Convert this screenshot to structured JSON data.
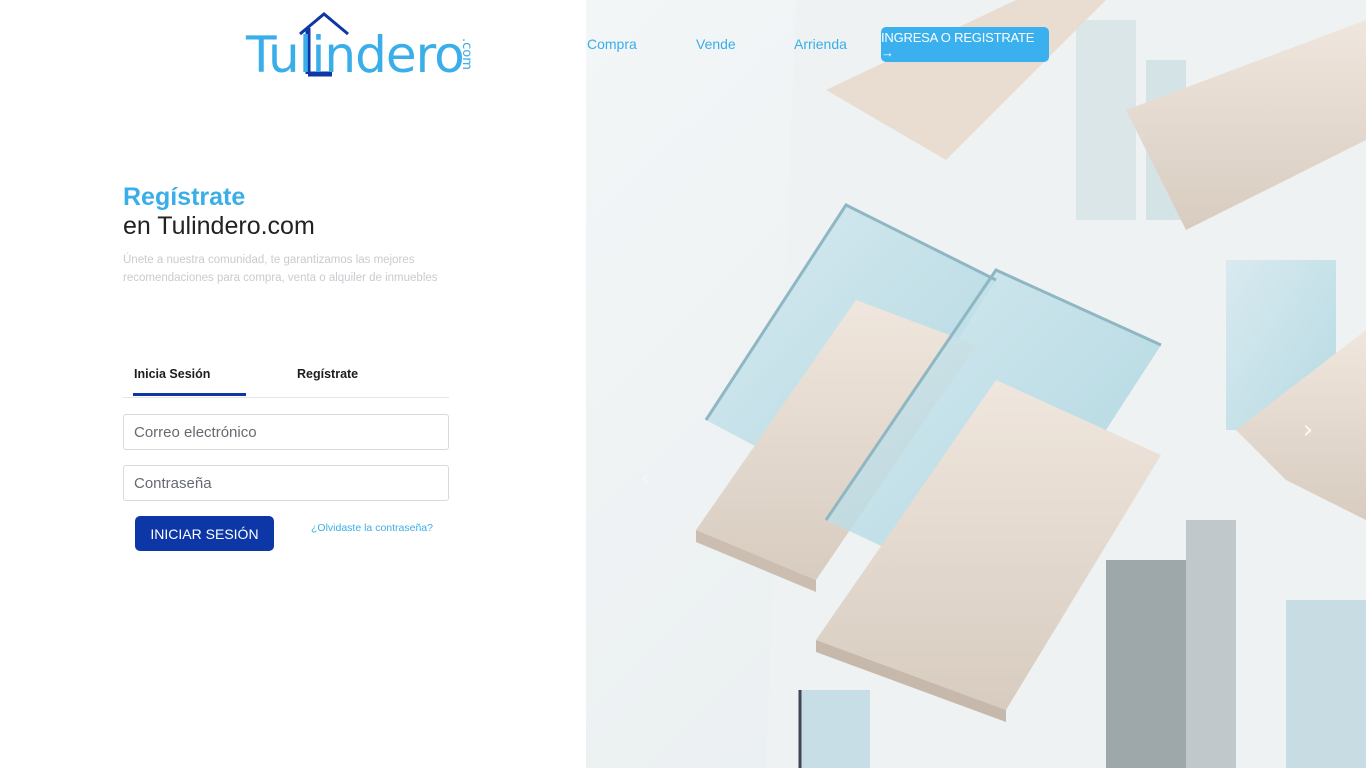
{
  "brand": {
    "logo_text": "Tulindero",
    "logo_suffix": ".com",
    "accent_color": "#3aaee8",
    "primary_color": "#0d37a6"
  },
  "nav": {
    "links": [
      "Compra",
      "Vende",
      "Arrienda"
    ],
    "cta_label": "INGRESA O REGISTRATE →"
  },
  "hero": {
    "title_highlight": "Regístrate",
    "title_rest": "en Tulindero.com",
    "intro": "Únete a nuestra comunidad, te garantizamos las mejores recomendaciones para compra, venta o alquiler de inmuebles"
  },
  "tabs": {
    "login": "Inicia Sesión",
    "register": "Regístrate",
    "active": "login"
  },
  "form": {
    "email_placeholder": "Correo electrónico",
    "password_placeholder": "Contraseña",
    "submit_label": "INICIAR SESIÓN",
    "forgot_label": "¿Olvidaste la contraseña?"
  },
  "carousel": {
    "prev_icon": "chevron-left-icon",
    "next_icon": "chevron-right-icon"
  }
}
